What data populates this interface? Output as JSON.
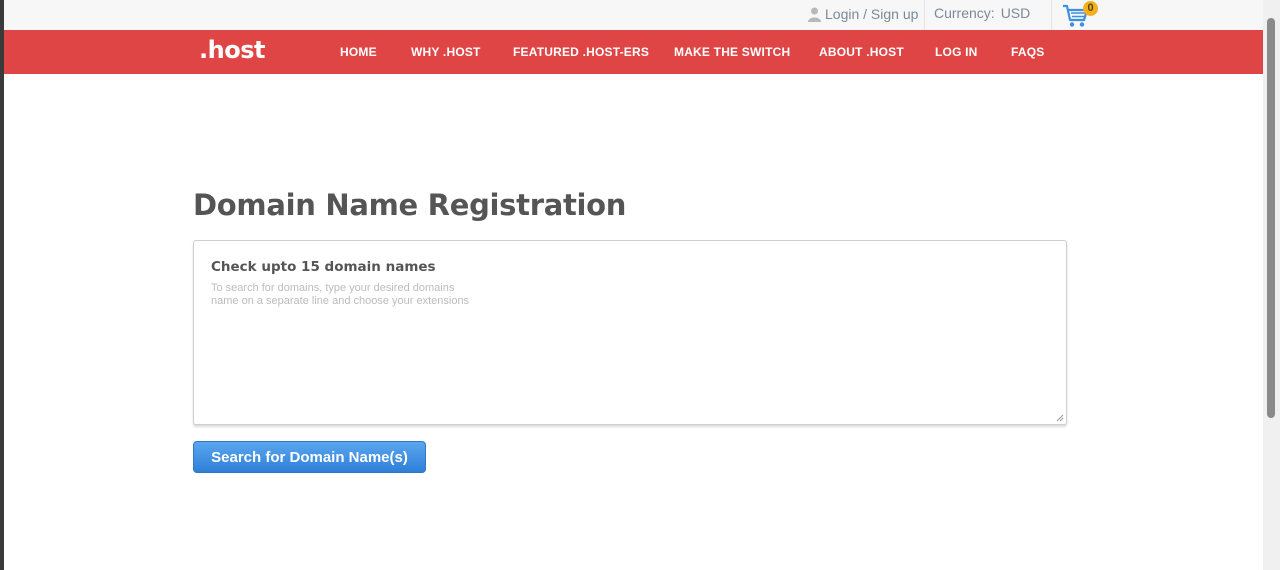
{
  "topbar": {
    "login_label": "Login / Sign up",
    "currency_label": "Currency:",
    "currency_value": "USD",
    "cart_count": "0"
  },
  "brand": {
    "logo_text": ".host"
  },
  "nav": {
    "items": [
      {
        "label": "HOME"
      },
      {
        "label": "WHY .HOST"
      },
      {
        "label": "FEATURED .HOST-ERS"
      },
      {
        "label": "MAKE THE SWITCH"
      },
      {
        "label": "ABOUT .HOST"
      },
      {
        "label": "LOG IN"
      },
      {
        "label": "FAQS"
      }
    ]
  },
  "main": {
    "title": "Domain Name Registration",
    "check_heading": "Check upto 15 domain names",
    "textarea_placeholder": "To search for domains, type your desired domains name on a separate line and choose your extensions",
    "search_button": "Search for Domain Name(s)"
  },
  "colors": {
    "nav_background": "#e04545",
    "button_blue": "#2e7fd9",
    "cart_badge": "#f2b01e"
  }
}
